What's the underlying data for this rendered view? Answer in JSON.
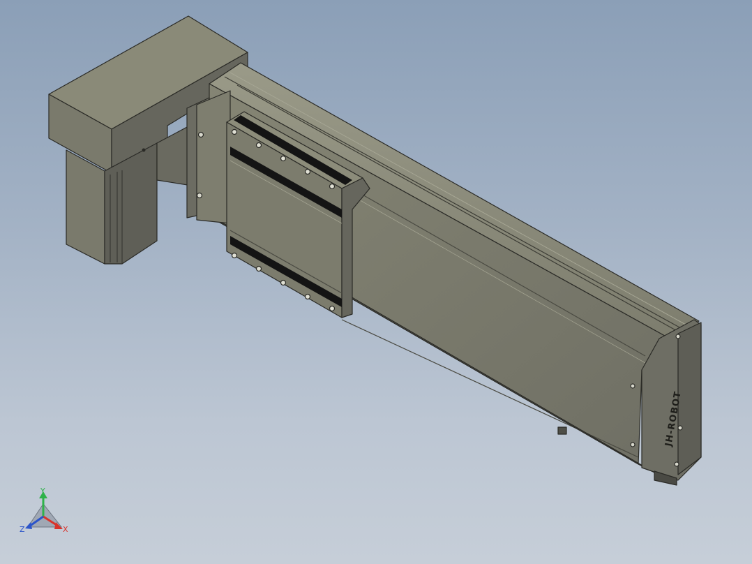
{
  "brand": {
    "logo_text": "JH-ROBOT"
  },
  "triad": {
    "x_label": "X",
    "y_label": "Y",
    "z_label": "Z"
  },
  "colors": {
    "background_top": "#8b9fb7",
    "background_bottom": "#c6ced8",
    "body_light": "#8a8a78",
    "body_mid": "#76766a",
    "body_dark": "#5c5c55",
    "edge": "#2a2a26",
    "slot_black": "#141414",
    "axis_x": "#d9332b",
    "axis_y": "#2fb24a",
    "axis_z": "#2b54c9"
  }
}
